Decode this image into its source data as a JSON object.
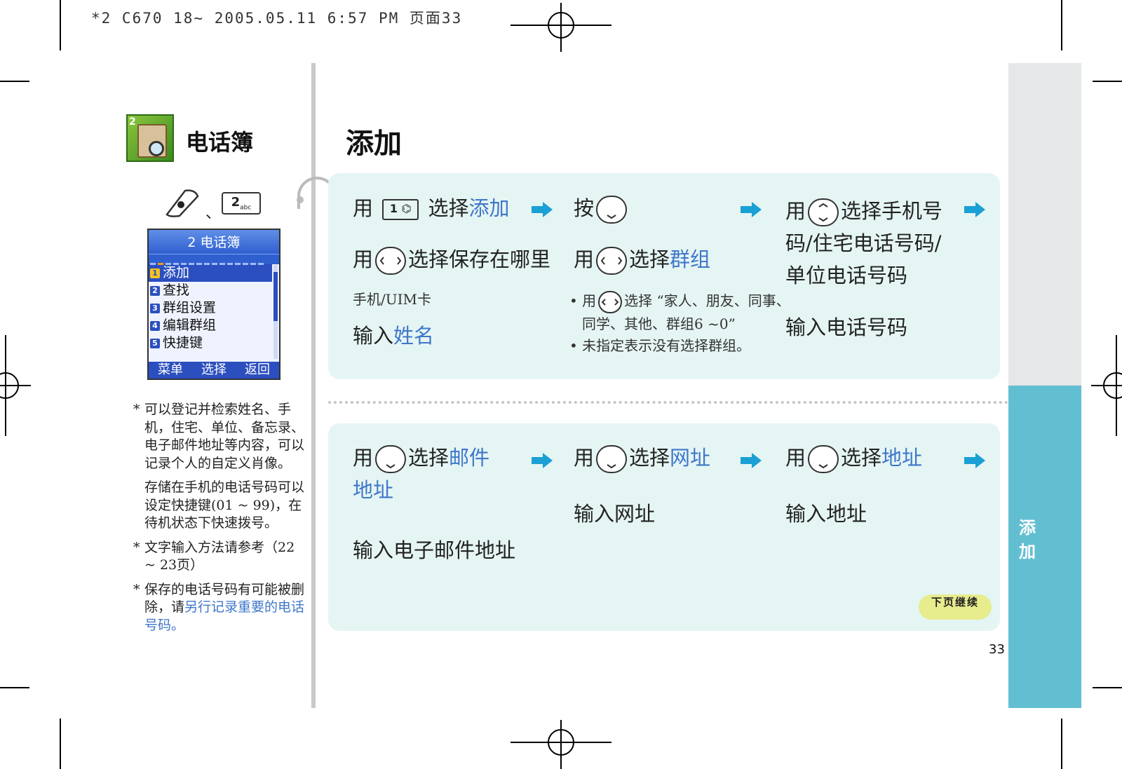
{
  "header_text": "*2 C670 18~ 2005.05.11 6:57 PM 页面33",
  "chapter": {
    "title": "电话簿",
    "icon_number": "2"
  },
  "page_title": "添加",
  "side_tab": {
    "label_1": "添",
    "label_2": "加"
  },
  "keys": {
    "separator": "、",
    "key2_label": "2",
    "key2_sub": "abc"
  },
  "phone_screen": {
    "title": "2 电话簿",
    "menu": [
      {
        "num": "1",
        "label": "添加"
      },
      {
        "num": "2",
        "label": "查找"
      },
      {
        "num": "3",
        "label": "群组设置"
      },
      {
        "num": "4",
        "label": "编辑群组"
      },
      {
        "num": "5",
        "label": "快捷键"
      }
    ],
    "softkeys": [
      "菜单",
      "选择",
      "返回"
    ]
  },
  "notes": {
    "n1": "可以登记并检索姓名、手机，住宅、单位、备忘录、电子邮件地址等内容，可以记录个人的自定义肖像。",
    "n2": "存储在手机的电话号码可以设定快捷键(01 ~ 99)，在待机状态下快速拨号。",
    "n3": "文字输入方法请参考（22 ~ 23页）",
    "n4_a": "保存的电话号码有可能被删除，请",
    "n4_b": "另行记录重要的电话号码。"
  },
  "steps": {
    "s1_use": "用",
    "s1_key": "1",
    "s1_select": "选择",
    "s1_hl": "添加",
    "s2_use": "用",
    "s2_text": "选择保存在哪里",
    "s2_sub": "手机/UIM卡",
    "s3_pre": "输入",
    "s3_hl": "姓名",
    "s4": "按",
    "s5_use": "用",
    "s5_select": "选择",
    "s5_hl": "群组",
    "b1_use": "用",
    "b1_text": "选择 “家人、朋友、同事、",
    "b1_text2": "同学、其他、群组6 ~0”",
    "b2": "未指定表示没有选择群组。",
    "s6_use": "用",
    "s6_l1": "选择手机号",
    "s6_l2": "码/住宅电话号码/",
    "s6_l3": "单位电话号码",
    "s7": "输入电话号码",
    "s8_use": "用",
    "s8_select": "选择",
    "s8_hl1": "邮件",
    "s8_hl2": "地址",
    "s9": "输入电子邮件地址",
    "s10_use": "用",
    "s10_select": "选择",
    "s10_hl": "网址",
    "s11": "输入网址",
    "s12_use": "用",
    "s12_select": "选择",
    "s12_hl": "地址",
    "s13": "输入地址"
  },
  "continue_badge": "下页继续",
  "page_number": "33",
  "colors": {
    "highlight": "#3f77c9",
    "panel": "#e5f5f4",
    "tab": "#62bfd2",
    "arrow": "#1aa0d4"
  }
}
